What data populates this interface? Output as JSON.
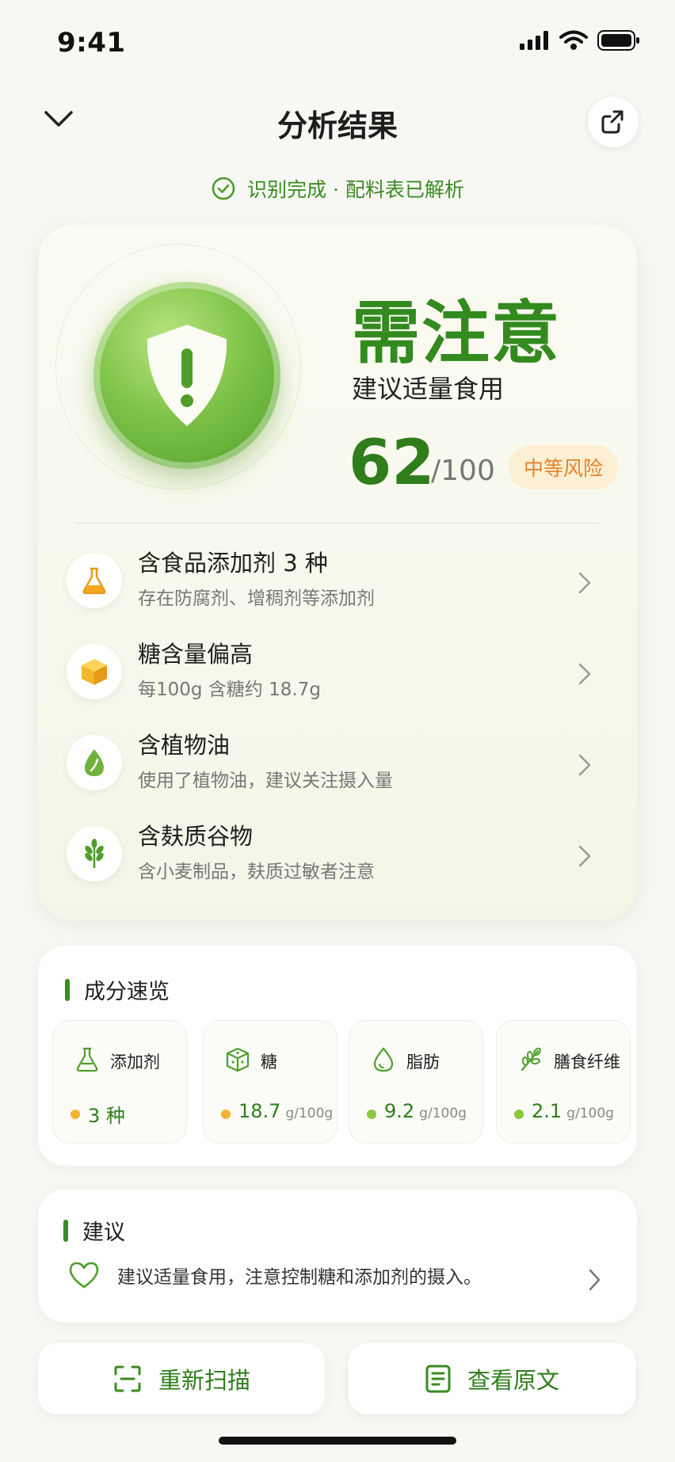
{
  "status_bar": {
    "time": "9:41"
  },
  "header": {
    "title": "分析结果"
  },
  "recognition": {
    "text": "识别完成 · 配料表已解析"
  },
  "verdict": {
    "title": "需注意",
    "subtitle": "建议适量食用",
    "score": "62",
    "score_max": "/100",
    "risk_label": "中等风险",
    "score_value": 62
  },
  "risk_items": [
    {
      "icon": "flask-icon",
      "title": "含食品添加剂 3 种",
      "desc": "存在防腐剂、增稠剂等添加剂"
    },
    {
      "icon": "sugar-cube-icon",
      "title": "糖含量偏高",
      "desc": "每100g 含糖约 18.7g"
    },
    {
      "icon": "oil-drop-icon",
      "title": "含植物油",
      "desc": "使用了植物油，建议关注摄入量"
    },
    {
      "icon": "wheat-icon",
      "title": "含麸质谷物",
      "desc": "含小麦制品，麸质过敏者注意"
    }
  ],
  "ingredients": {
    "title": "成分速览",
    "items": [
      {
        "icon": "flask-icon",
        "name": "添加剂",
        "value": "3 种",
        "unit": "",
        "dot_color": "#f2b233"
      },
      {
        "icon": "sugar-cube-icon",
        "name": "糖",
        "value": "18.7",
        "unit": "g/100g",
        "dot_color": "#f2b233"
      },
      {
        "icon": "oil-drop-icon",
        "name": "脂肪",
        "value": "9.2",
        "unit": "g/100g",
        "dot_color": "#8cc63f"
      },
      {
        "icon": "wheat-icon",
        "name": "膳食纤维",
        "value": "2.1",
        "unit": "g/100g",
        "dot_color": "#8cc63f"
      }
    ]
  },
  "advice": {
    "title": "建议",
    "text": "建议适量食用，注意控制糖和添加剂的摄入。"
  },
  "buttons": {
    "rescan": "重新扫描",
    "view_original": "查看原文"
  },
  "colors": {
    "accent_green": "#3b8a22",
    "risk_orange": "#e5822a",
    "risk_bg": "#fdefd3"
  }
}
